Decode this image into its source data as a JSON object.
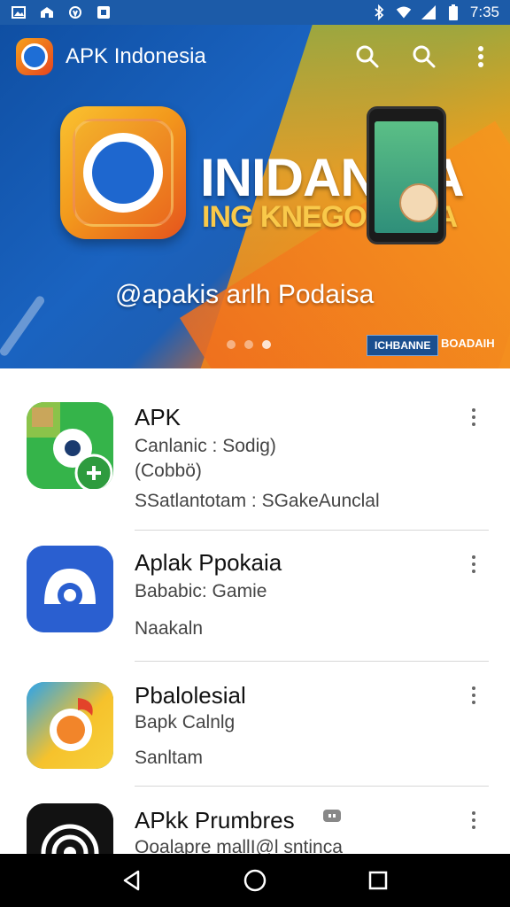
{
  "status_bar": {
    "time": "7:35"
  },
  "appbar": {
    "title": "APK Indonesia"
  },
  "banner": {
    "title": "INIDANSIA",
    "subtitle": "ING KNEGORAIDA",
    "tagline": "@apakis  arlh Podaisa",
    "badge_left": "ICHBANNE",
    "badge_right": "BOADAIH"
  },
  "apps": [
    {
      "title": "APK",
      "line2": "Canlanic : Sodig)",
      "line3": "(Cobbö)",
      "line4": "SSatlantotam   : SGakeAunclal"
    },
    {
      "title": "Aplak Ppokaia",
      "line2": "Bababic: Gamie",
      "line3": "",
      "line4": "Naakaln"
    },
    {
      "title": "Pbalolesial",
      "line2": "Bapk Calnlg",
      "line3": "",
      "line4": "Sanltam"
    },
    {
      "title": "APkk Prumbres",
      "line2": "Ooalapre mallI@l  sntinca",
      "line3": "",
      "line4": ""
    }
  ],
  "colors": {
    "status_bar": "#1c5ba8",
    "hero_blue": "#1a63c0",
    "hero_orange": "#f28a18",
    "navbar": "#000000"
  },
  "icons": [
    "gallery-icon",
    "home-icon",
    "location-icon",
    "message-icon",
    "bluetooth-icon",
    "wifi-icon",
    "signal-icon",
    "battery-icon",
    "search-icon",
    "overflow-menu-icon",
    "back-icon",
    "home-nav-icon",
    "recents-icon"
  ]
}
